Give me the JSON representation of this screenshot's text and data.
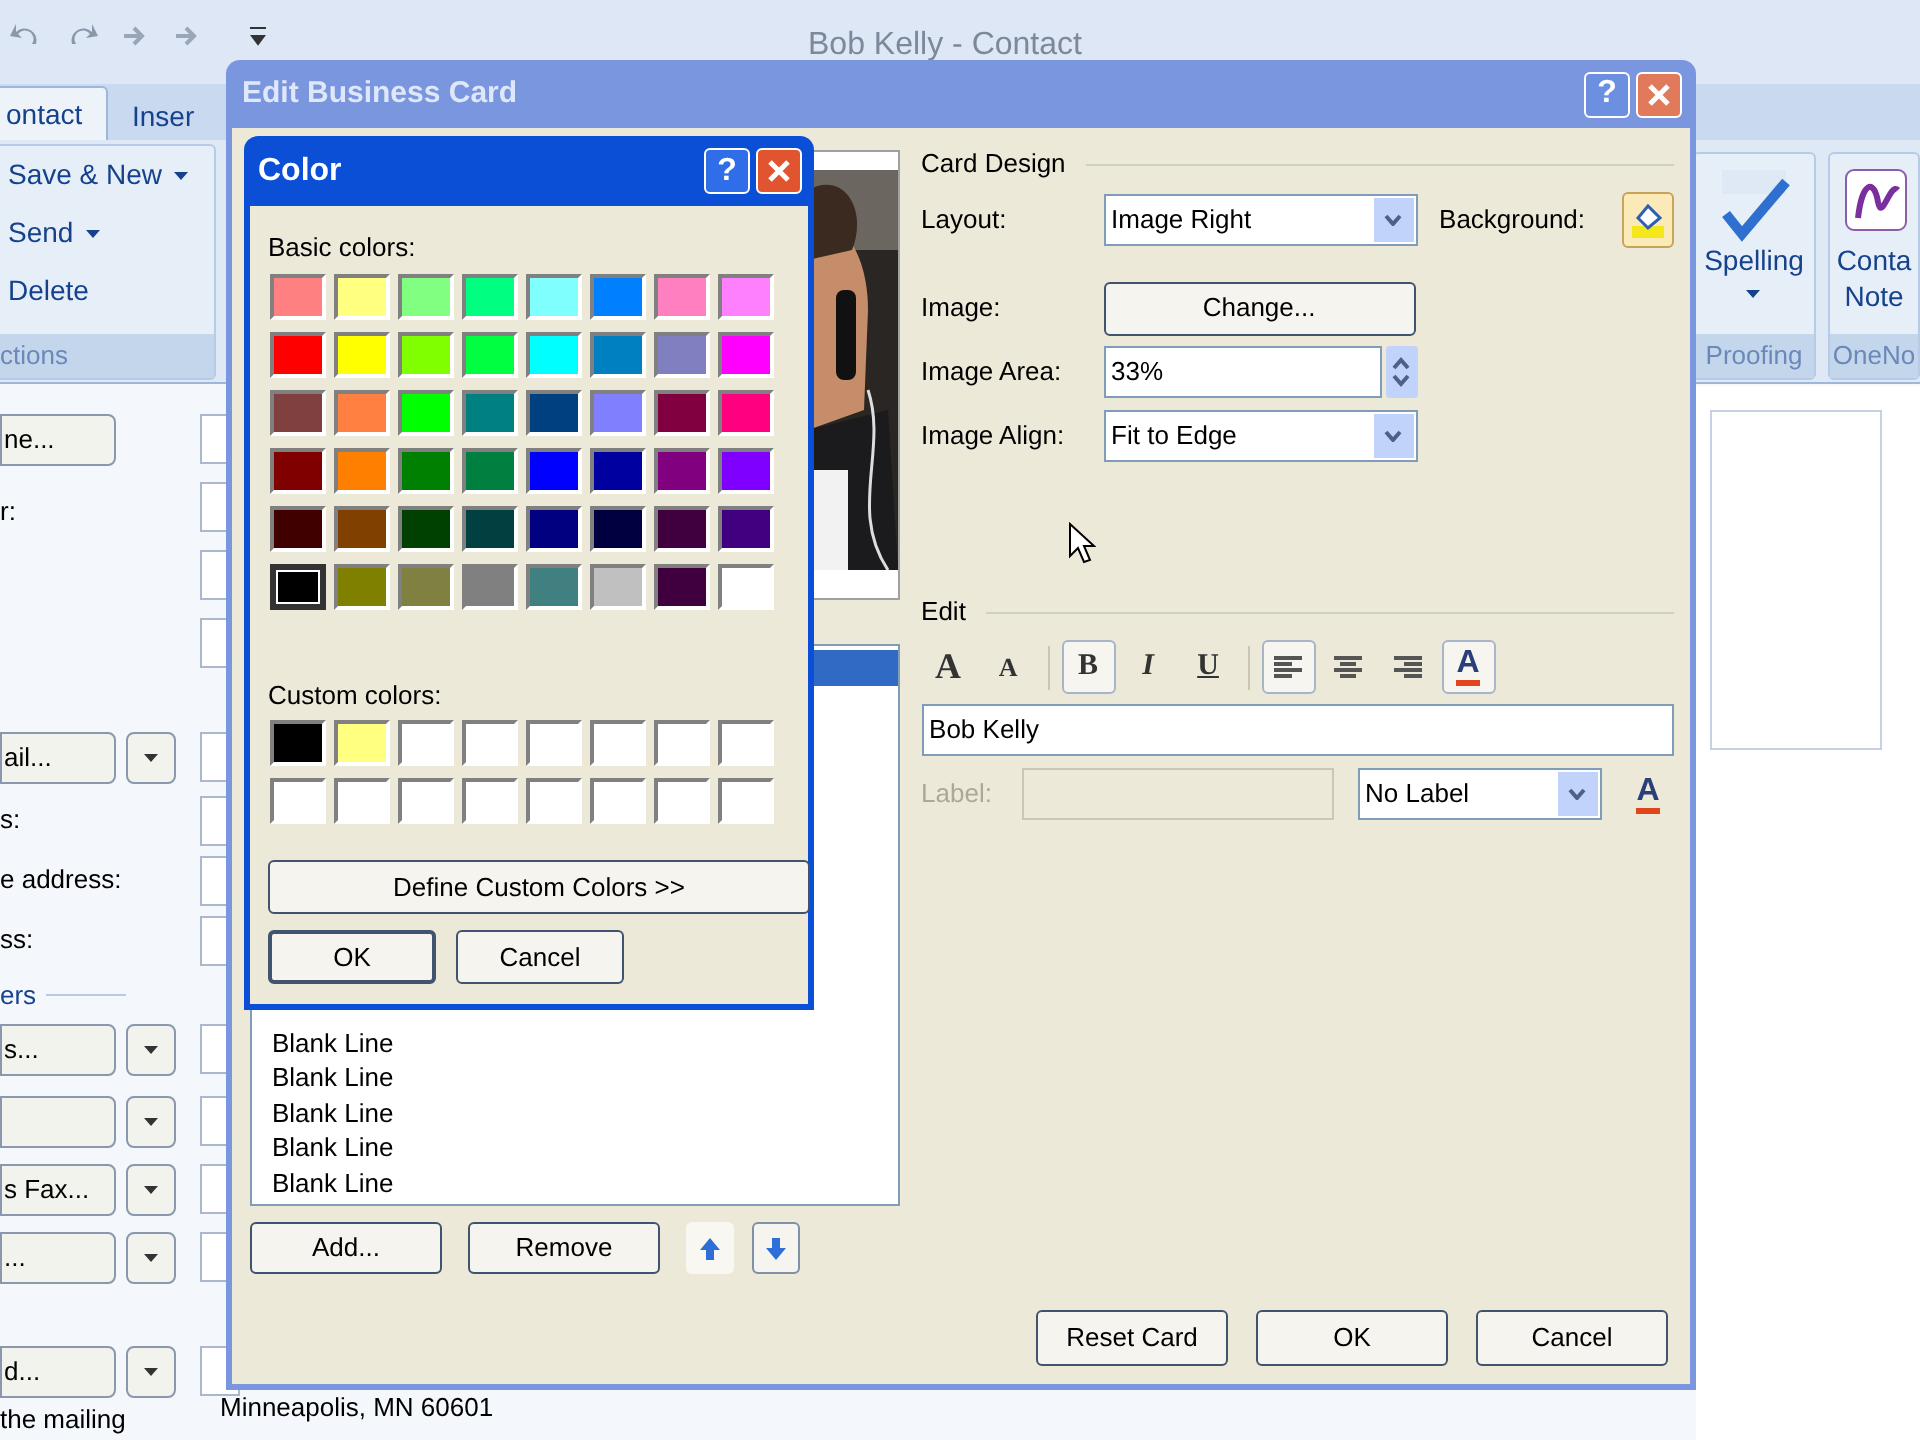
{
  "outlook_window": {
    "title": "Bob Kelly - Contact",
    "tabs": [
      {
        "label": "ontact",
        "selected": true
      },
      {
        "label": "Inser",
        "selected": false
      }
    ],
    "ribbon_left": {
      "commands": [
        {
          "label": "Save & New",
          "dropdown": true
        },
        {
          "label": "Send",
          "dropdown": true
        },
        {
          "label": "Delete",
          "dropdown": false
        }
      ],
      "group_label": "ctions"
    },
    "ribbon_right": [
      {
        "kind": "spelling",
        "lines": [
          "Spelling"
        ],
        "dropdown": true,
        "group_label": "Proofing"
      },
      {
        "kind": "note",
        "lines": [
          "Conta",
          "Note"
        ],
        "dropdown": false,
        "group_label": "OneNo"
      }
    ],
    "form_rows": [
      {
        "kind": "button",
        "label": "ne...",
        "dropdown": false
      },
      {
        "kind": "label",
        "label": "r:"
      },
      {
        "kind": "button",
        "label": "ail...",
        "dropdown": true
      },
      {
        "kind": "label",
        "label": "s:"
      },
      {
        "kind": "label",
        "label": "e address:"
      },
      {
        "kind": "label",
        "label": "ss:"
      },
      {
        "kind": "section",
        "label": "ers"
      },
      {
        "kind": "button",
        "label": "s...",
        "dropdown": true
      },
      {
        "kind": "button",
        "dropdown": true
      },
      {
        "kind": "button",
        "label": "s Fax...",
        "dropdown": true
      },
      {
        "kind": "button",
        "label": "...",
        "dropdown": true
      },
      {
        "kind": "button",
        "label": "d...",
        "dropdown": true
      },
      {
        "kind": "label",
        "label": "the mailing"
      }
    ],
    "address_text": "Minneapolis, MN 60601"
  },
  "edit_business_card": {
    "title": "Edit Business Card",
    "help_button": "?",
    "fields_list": [
      {
        "selected": true
      },
      {
        "text": "Blank Line",
        "selected": false
      },
      {
        "text": "Blank Line",
        "selected": false
      },
      {
        "text": "Blank Line",
        "selected": false
      },
      {
        "text": "Blank Line",
        "selected": false
      },
      {
        "text": "Blank Line",
        "selected": false
      }
    ],
    "list_buttons": [
      {
        "kind": "text",
        "label": "Add..."
      },
      {
        "kind": "text",
        "label": "Remove"
      },
      {
        "kind": "move_up"
      },
      {
        "kind": "move_down"
      }
    ],
    "card_design": {
      "heading": "Card Design",
      "layout": {
        "label": "Layout:",
        "value": "Image Right"
      },
      "background_label": "Background:",
      "image": {
        "label": "Image:",
        "button": "Change..."
      },
      "image_area": {
        "label": "Image Area:",
        "value": "33%"
      },
      "image_align": {
        "label": "Image Align:",
        "value": "Fit to Edge"
      }
    },
    "edit": {
      "heading": "Edit",
      "toolbar": [
        {
          "kind": "grow_font",
          "glyph": "A",
          "selected": false
        },
        {
          "kind": "shrink_font",
          "glyph": "A",
          "selected": false
        },
        {
          "kind": "bold",
          "glyph": "B",
          "selected": true
        },
        {
          "kind": "italic",
          "glyph": "I",
          "selected": false
        },
        {
          "kind": "underline",
          "glyph": "U",
          "selected": false
        },
        {
          "kind": "align_left",
          "selected": true
        },
        {
          "kind": "align_center",
          "selected": false
        },
        {
          "kind": "align_right",
          "selected": false
        },
        {
          "kind": "font_color",
          "glyph": "A",
          "selected": true
        }
      ],
      "text_value": "Bob Kelly",
      "label": {
        "label": "Label:",
        "disabled": true
      },
      "label_position": "No Label",
      "label_font_color_glyph": "A"
    },
    "footer_buttons": [
      "Reset Card",
      "OK",
      "Cancel"
    ]
  },
  "color_dialog": {
    "title": "Color",
    "help_button": "?",
    "basic_label": "Basic colors:",
    "basic_colors": [
      {
        "color": "#ff8080",
        "selected": false
      },
      {
        "color": "#ffff80",
        "selected": false
      },
      {
        "color": "#80ff80",
        "selected": false
      },
      {
        "color": "#00ff80",
        "selected": false
      },
      {
        "color": "#80ffff",
        "selected": false
      },
      {
        "color": "#0080ff",
        "selected": false
      },
      {
        "color": "#ff80c0",
        "selected": false
      },
      {
        "color": "#ff80ff",
        "selected": false
      },
      {
        "color": "#ff0000",
        "selected": false
      },
      {
        "color": "#ffff00",
        "selected": false
      },
      {
        "color": "#80ff00",
        "selected": false
      },
      {
        "color": "#00ff40",
        "selected": false
      },
      {
        "color": "#00ffff",
        "selected": false
      },
      {
        "color": "#0080c0",
        "selected": false
      },
      {
        "color": "#8080c0",
        "selected": false
      },
      {
        "color": "#ff00ff",
        "selected": false
      },
      {
        "color": "#804040",
        "selected": false
      },
      {
        "color": "#ff8040",
        "selected": false
      },
      {
        "color": "#00ff00",
        "selected": false
      },
      {
        "color": "#008080",
        "selected": false
      },
      {
        "color": "#004080",
        "selected": false
      },
      {
        "color": "#8080ff",
        "selected": false
      },
      {
        "color": "#800040",
        "selected": false
      },
      {
        "color": "#ff0080",
        "selected": false
      },
      {
        "color": "#800000",
        "selected": false
      },
      {
        "color": "#ff8000",
        "selected": false
      },
      {
        "color": "#008000",
        "selected": false
      },
      {
        "color": "#008040",
        "selected": false
      },
      {
        "color": "#0000ff",
        "selected": false
      },
      {
        "color": "#0000a0",
        "selected": false
      },
      {
        "color": "#800080",
        "selected": false
      },
      {
        "color": "#8000ff",
        "selected": false
      },
      {
        "color": "#400000",
        "selected": false
      },
      {
        "color": "#804000",
        "selected": false
      },
      {
        "color": "#004000",
        "selected": false
      },
      {
        "color": "#004040",
        "selected": false
      },
      {
        "color": "#000080",
        "selected": false
      },
      {
        "color": "#000040",
        "selected": false
      },
      {
        "color": "#400040",
        "selected": false
      },
      {
        "color": "#400080",
        "selected": false
      },
      {
        "color": "#000000",
        "selected": true
      },
      {
        "color": "#808000",
        "selected": false
      },
      {
        "color": "#808040",
        "selected": false
      },
      {
        "color": "#808080",
        "selected": false
      },
      {
        "color": "#408080",
        "selected": false
      },
      {
        "color": "#c0c0c0",
        "selected": false
      },
      {
        "color": "#400040",
        "selected": false
      },
      {
        "color": "#ffffff",
        "selected": false
      }
    ],
    "custom_label": "Custom colors:",
    "custom_colors": [
      {
        "color": "#000000"
      },
      {
        "color": "#ffff80"
      },
      {
        "color": "#ffffff"
      },
      {
        "color": "#ffffff"
      },
      {
        "color": "#ffffff"
      },
      {
        "color": "#ffffff"
      },
      {
        "color": "#ffffff"
      },
      {
        "color": "#ffffff"
      },
      {
        "color": "#ffffff"
      },
      {
        "color": "#ffffff"
      },
      {
        "color": "#ffffff"
      },
      {
        "color": "#ffffff"
      },
      {
        "color": "#ffffff"
      },
      {
        "color": "#ffffff"
      },
      {
        "color": "#ffffff"
      },
      {
        "color": "#ffffff"
      }
    ],
    "define_button": "Define Custom Colors >>",
    "buttons": [
      "OK",
      "Cancel"
    ]
  }
}
